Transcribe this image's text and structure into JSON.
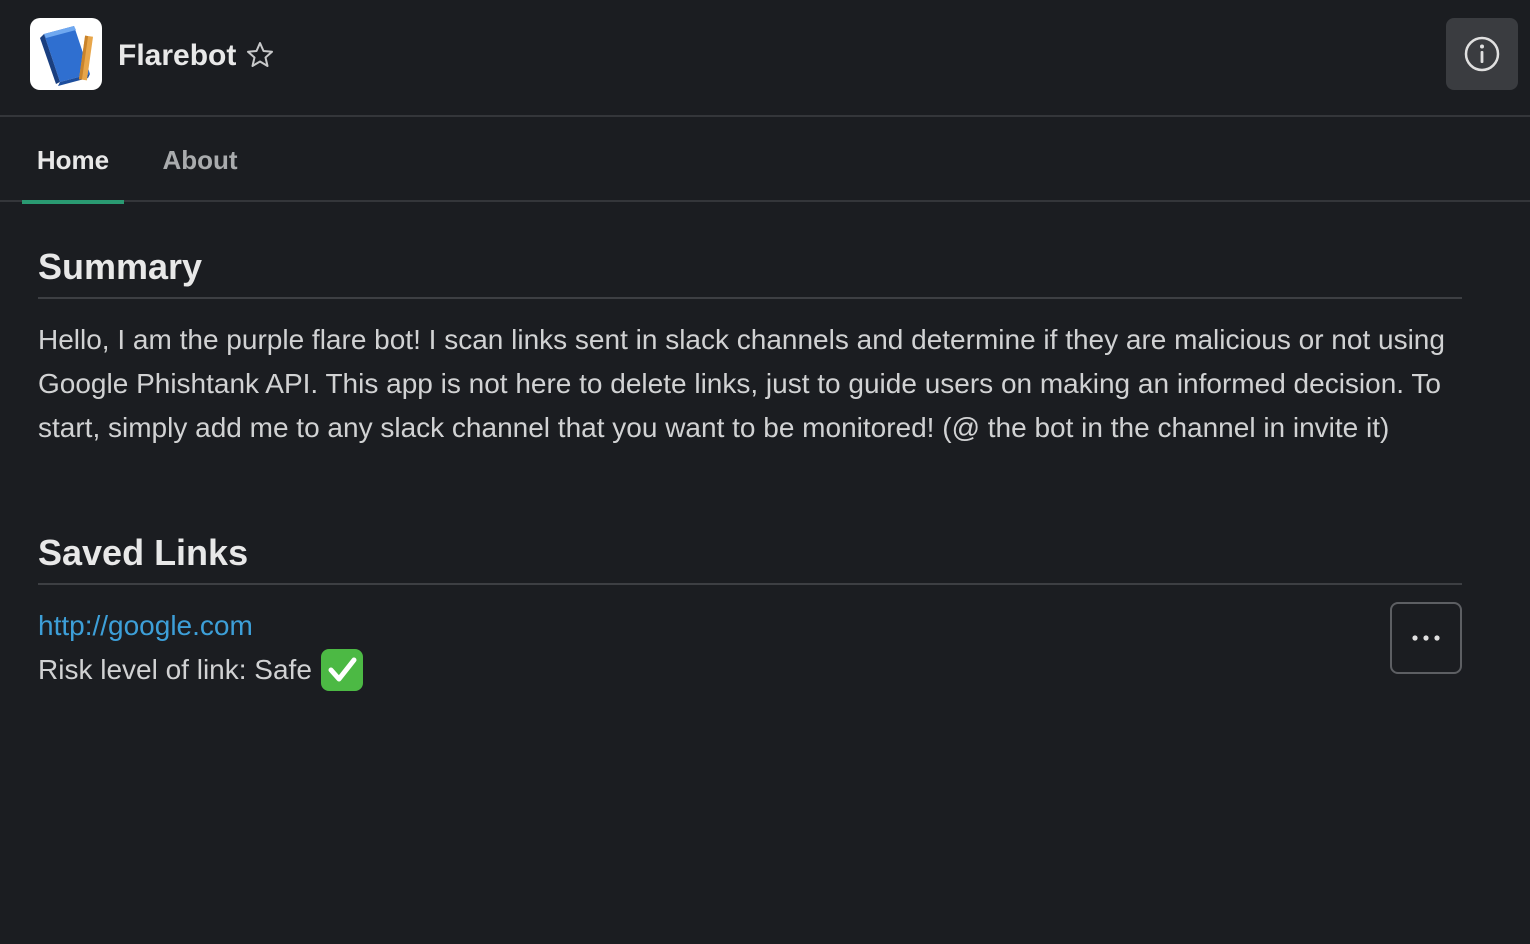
{
  "header": {
    "app_name": "Flarebot",
    "app_icon": "book-icon",
    "star_icon": "star-icon",
    "info_icon": "info-icon"
  },
  "tabs": [
    {
      "label": "Home",
      "active": true
    },
    {
      "label": "About",
      "active": false
    }
  ],
  "summary": {
    "title": "Summary",
    "text": "Hello, I am the purple flare bot! I scan links sent in slack channels and determine if they are malicious or not using Google Phishtank API. This app is not here to delete links, just to guide users on making an informed decision. To start, simply add me to any slack channel that you want to be monitored! (@ the bot in the channel in invite it)"
  },
  "saved_links": {
    "title": "Saved Links",
    "items": [
      {
        "url": "http://google.com",
        "risk_text": "Risk level of link: Safe",
        "status_icon": "check-mark-icon",
        "more_icon": "more-icon"
      }
    ]
  },
  "colors": {
    "background": "#1b1d21",
    "accent_tab": "#2a9a72",
    "link": "#3d9fd8",
    "check_green": "#4cb944"
  }
}
